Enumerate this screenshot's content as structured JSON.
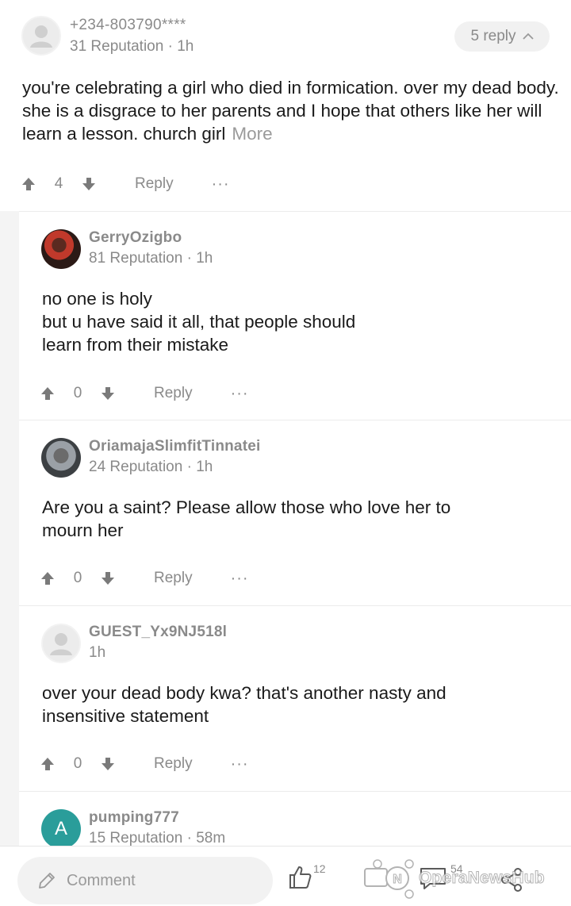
{
  "top_comment": {
    "username": "+234-803790****",
    "meta": "31 Reputation · 1h",
    "reply_count_label": "5 reply",
    "body": "you're celebrating a girl who died in formication. over my dead body. she is a disgrace to her parents and I hope that others like her will learn a lesson. church girl",
    "more_label": "More",
    "votes": "4",
    "reply_label": "Reply",
    "more_options": "···"
  },
  "replies": [
    {
      "username": "GerryOzigbo",
      "meta": "81 Reputation · 1h",
      "body": "no one is holy\nbut u  have said it all, that people should\nlearn from their mistake",
      "votes": "0",
      "reply_label": "Reply",
      "more_options": "···"
    },
    {
      "username": "OriamajaSlimfitTinnatei",
      "meta": "24 Reputation · 1h",
      "body": "Are you a saint? Please allow those who love her to\nmourn her",
      "votes": "0",
      "reply_label": "Reply",
      "more_options": "···"
    },
    {
      "username": "GUEST_Yx9NJ518l",
      "meta": "1h",
      "body": "over your dead body kwa? that's another nasty and\ninsensitive statement",
      "votes": "0",
      "reply_label": "Reply",
      "more_options": "···"
    },
    {
      "username": "pumping777",
      "meta": "15 Reputation · 58m",
      "avatar_letter": "A"
    }
  ],
  "bottom_bar": {
    "comment_placeholder": "Comment",
    "like_count": "12",
    "comment_count": "54",
    "watermark": "OperaNewsHub"
  },
  "icons": {
    "upvote": "arrow-up-icon",
    "downvote": "arrow-down-icon",
    "chevron": "chevron-up-icon",
    "pencil": "pencil-icon",
    "like": "thumbs-up-icon",
    "chat": "chat-bubble-icon",
    "share": "share-icon"
  },
  "colors": {
    "muted_text": "#8a8a8a",
    "accent_avatar": "#2a9d9a",
    "thread_rail": "#f4f4f4"
  }
}
